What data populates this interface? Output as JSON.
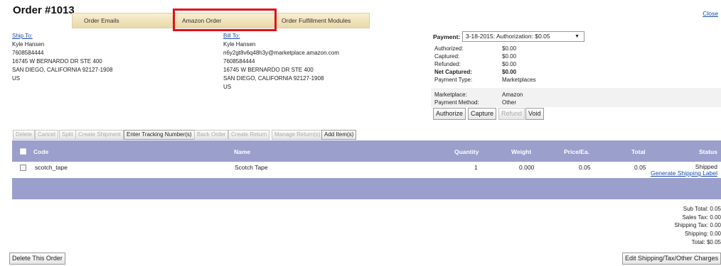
{
  "order": {
    "title": "Order #1013"
  },
  "tabs": [
    {
      "label": "Order Emails"
    },
    {
      "label": "Amazon Order"
    },
    {
      "label": "Order Fulfillment Modules"
    }
  ],
  "close_label": "Close",
  "ship_to": {
    "header": "Ship To:",
    "lines": [
      "Kyle Hansen",
      "7608584444",
      "16745 W BERNARDO DR STE 400",
      "SAN DIEGO, CALIFORNIA 92127-1908",
      "US"
    ]
  },
  "bill_to": {
    "header": "Bill To:",
    "lines": [
      "Kyle Hansen",
      "n6y2gt8v6q48h3y@marketplace.amazon.com",
      "7608584444",
      "16745 W BERNARDO DR STE 400",
      "SAN DIEGO, CALIFORNIA 92127-1908",
      "US"
    ]
  },
  "payment": {
    "label": "Payment:",
    "selected": "3-18-2015: Authorization: $0.05",
    "rows": [
      {
        "k": "Authorized:",
        "v": "$0.00"
      },
      {
        "k": "Captured:",
        "v": "$0.00"
      },
      {
        "k": "Refunded:",
        "v": "$0.00"
      },
      {
        "k": "Net Captured:",
        "v": "$0.00"
      },
      {
        "k": "Payment Type:",
        "v": "Marketplaces"
      },
      {
        "k": "Marketplace:",
        "v": "Amazon"
      },
      {
        "k": "Payment Method:",
        "v": "Other"
      }
    ],
    "buttons": {
      "authorize": "Authorize",
      "capture": "Capture",
      "refund": "Refund",
      "void": "Void"
    }
  },
  "actions": {
    "delete": "Delete",
    "cancel": "Cancel",
    "split": "Split",
    "create_shipment": "Create Shipment",
    "enter_tracking": "Enter Tracking Number(s)",
    "back_order": "Back Order",
    "create_return": "Create Return",
    "manage_returns": "Manage Return(s)",
    "add_items": "Add Item(s)"
  },
  "table": {
    "headers": {
      "code": "Code",
      "name": "Name",
      "quantity": "Quantity",
      "weight": "Weight",
      "price": "Price/Ea.",
      "total": "Total",
      "status": "Status"
    },
    "rows": [
      {
        "code": "scotch_tape",
        "name": "Scotch Tape",
        "quantity": "1",
        "weight": "0.000",
        "price": "0.05",
        "total": "0.05",
        "status": "Shipped",
        "link": "Generate Shipping Label"
      }
    ]
  },
  "totals": [
    "Sub Total:  0.05",
    "Sales Tax:  0.00",
    "Shipping Tax:  0.00",
    "Shipping:  0.00",
    "Total: $0.05"
  ],
  "bottom": {
    "delete_order": "Delete This Order",
    "edit_charges": "Edit Shipping/Tax/Other Charges"
  },
  "colors": {
    "table_header": "#9a9fcb",
    "tab_bar": "#e9d9a8",
    "highlight": "#e0121a",
    "link": "#1a4aa8"
  }
}
